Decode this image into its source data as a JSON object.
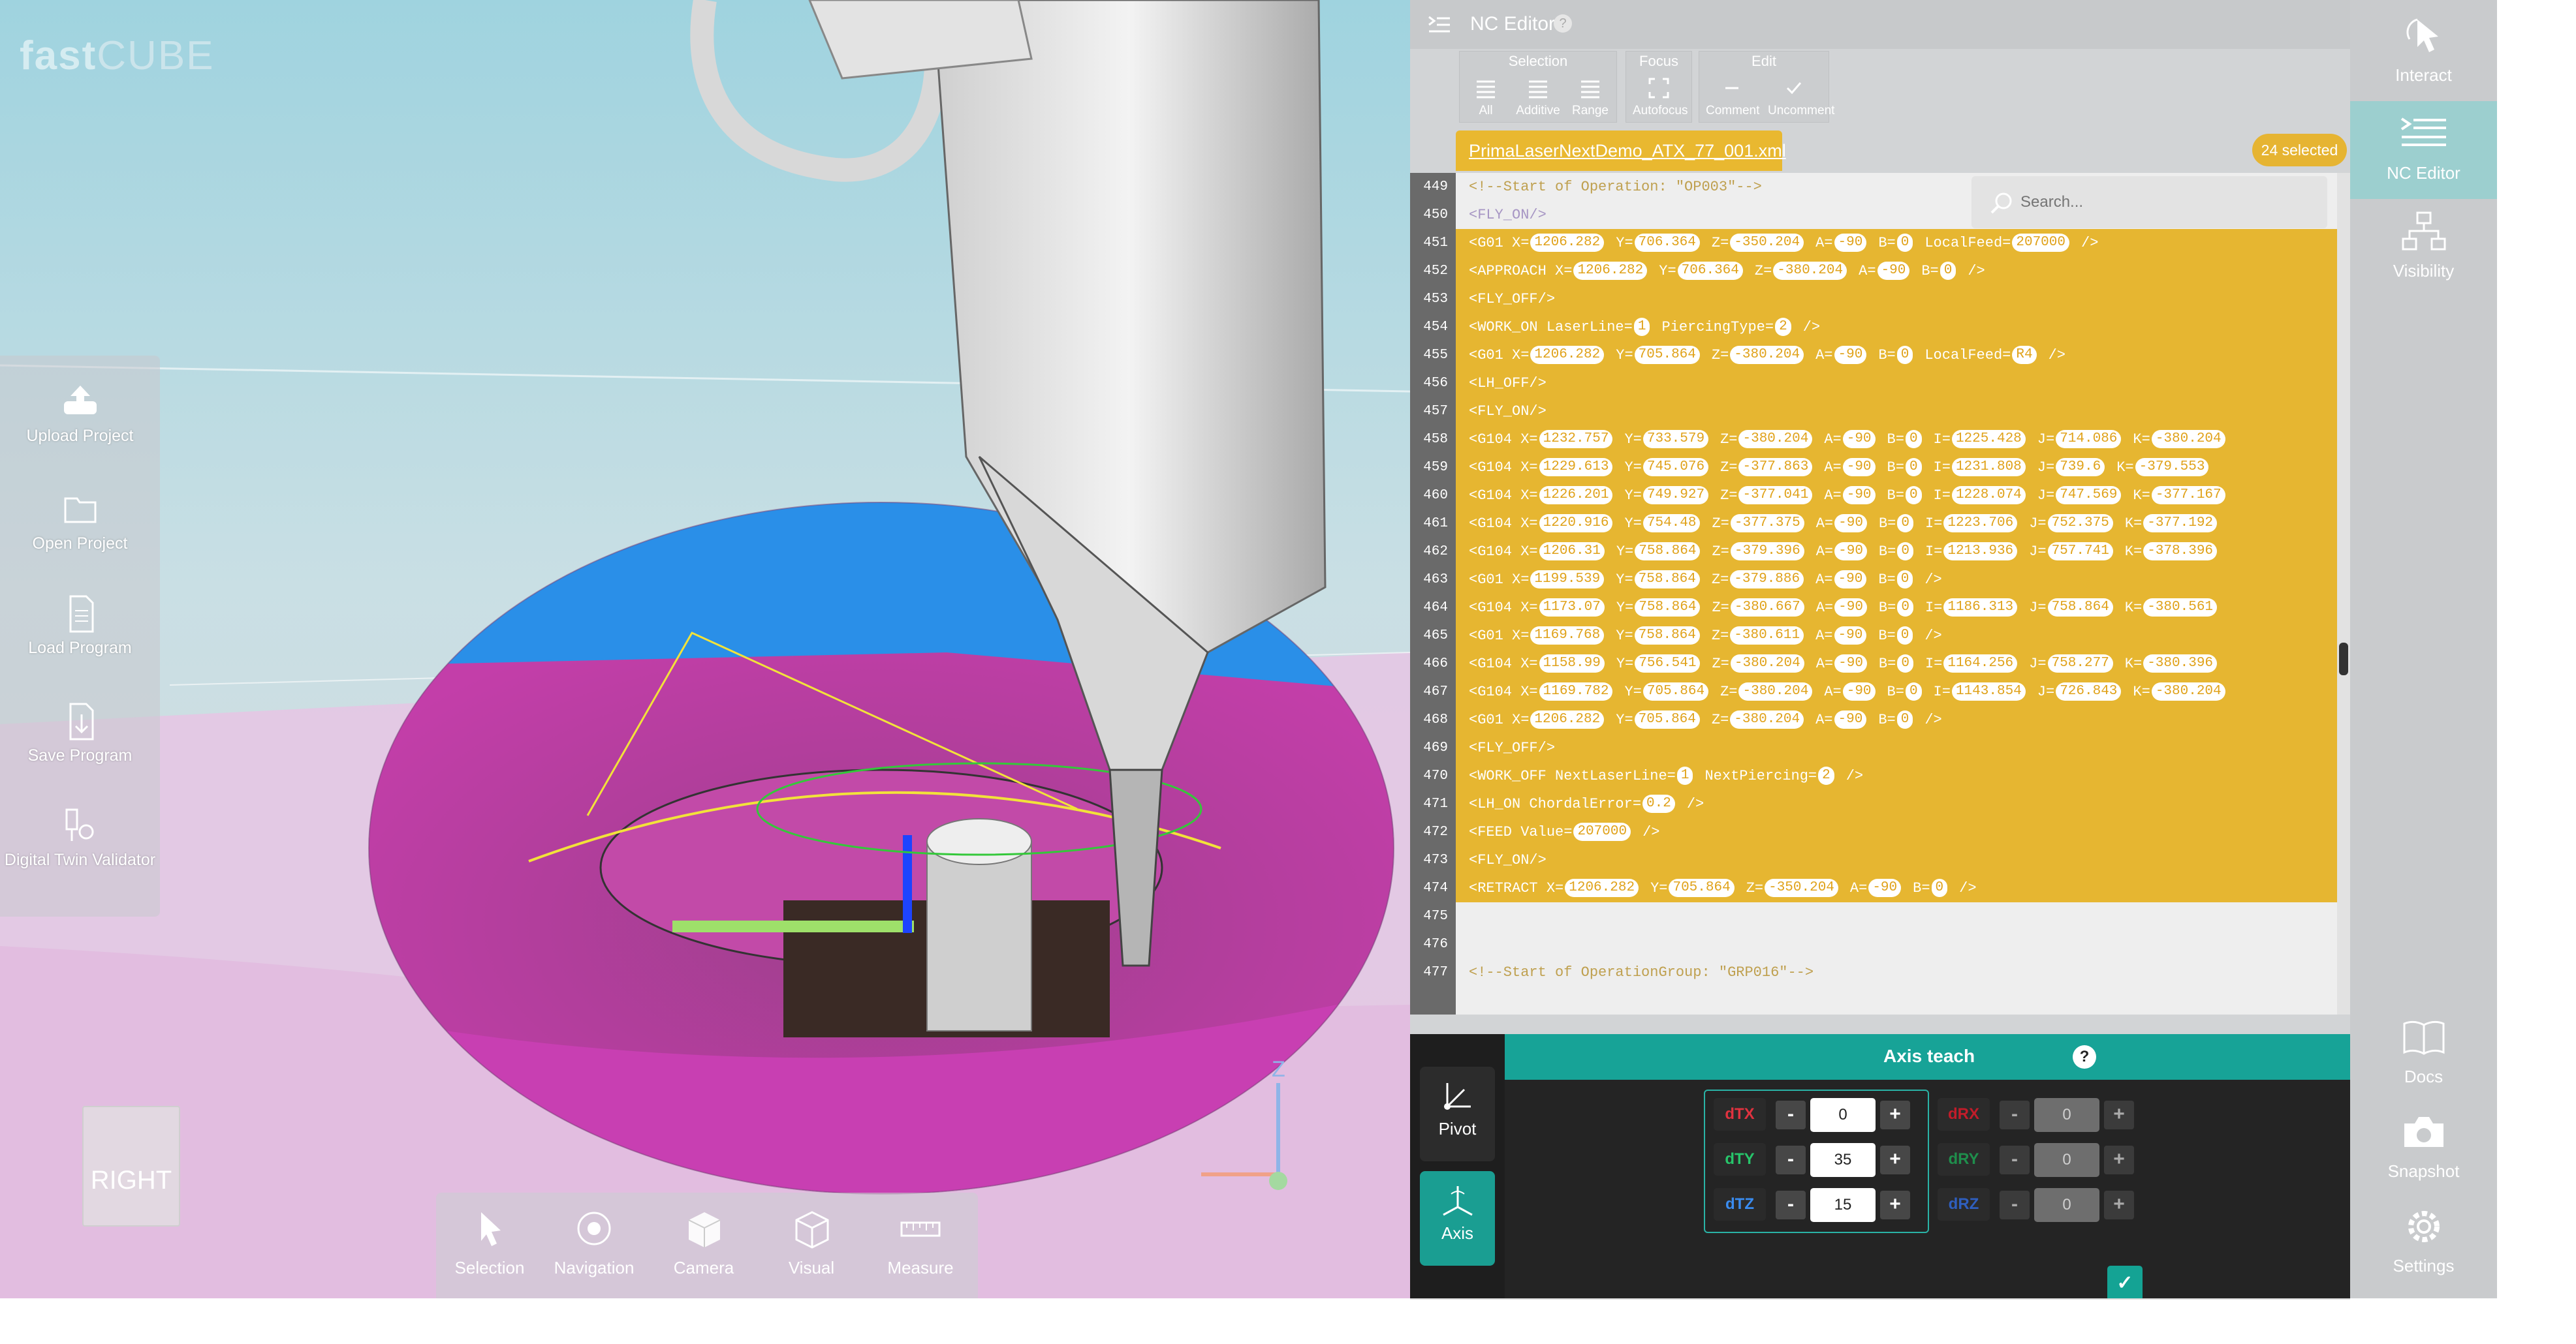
{
  "logo": {
    "fast": "fast",
    "cube": "CUBE"
  },
  "left_tools": [
    {
      "label": "Upload Project",
      "icon": "upload-project-icon"
    },
    {
      "label": "Open Project",
      "icon": "folder-icon"
    },
    {
      "label": "Load Program",
      "icon": "document-icon"
    },
    {
      "label": "Save Program",
      "icon": "save-program-icon"
    },
    {
      "label": "Digital Twin Validator",
      "icon": "digital-twin-icon"
    }
  ],
  "view_cube": {
    "face": "RIGHT"
  },
  "bottom_tools": [
    {
      "label": "Selection",
      "icon": "cursor-icon"
    },
    {
      "label": "Navigation",
      "icon": "navigation-icon"
    },
    {
      "label": "Camera",
      "icon": "camera-cube-icon"
    },
    {
      "label": "Visual",
      "icon": "visual-cube-icon"
    },
    {
      "label": "Measure",
      "icon": "ruler-icon"
    }
  ],
  "axis_gizmo": {
    "z_label": "Z"
  },
  "nc_editor": {
    "title": "NC Editor",
    "help": "?",
    "ribbon": {
      "selection": {
        "title": "Selection",
        "buttons": [
          "All",
          "Additive",
          "Range"
        ]
      },
      "focus": {
        "title": "Focus",
        "buttons": [
          "Autofocus"
        ]
      },
      "edit": {
        "title": "Edit",
        "buttons": [
          "Comment",
          "Uncomment"
        ]
      }
    },
    "file_tab": "PrimaLaserNextDemo_ATX_77_001.xml",
    "selected_badge": "24 selected",
    "search_placeholder": "Search...",
    "lines": [
      {
        "n": "449",
        "style": "cmt",
        "parts": [
          {
            "t": "<!--Start of Operation: \"OP003\"-->"
          }
        ]
      },
      {
        "n": "450",
        "style": "dim",
        "parts": [
          {
            "t": "<FLY_ON/>"
          }
        ]
      },
      {
        "n": "451",
        "style": "hl",
        "parts": [
          {
            "t": "<G01 X="
          },
          {
            "v": "1206.282"
          },
          {
            "t": "Y="
          },
          {
            "v": "706.364"
          },
          {
            "t": "Z="
          },
          {
            "v": "-350.204"
          },
          {
            "t": "A="
          },
          {
            "v": "-90"
          },
          {
            "t": "B="
          },
          {
            "v": "0"
          },
          {
            "t": "LocalFeed="
          },
          {
            "v": "207000"
          },
          {
            "t": "/>"
          }
        ]
      },
      {
        "n": "452",
        "style": "hl",
        "parts": [
          {
            "t": "<APPROACH X="
          },
          {
            "v": "1206.282"
          },
          {
            "t": "Y="
          },
          {
            "v": "706.364"
          },
          {
            "t": "Z="
          },
          {
            "v": "-380.204"
          },
          {
            "t": "A="
          },
          {
            "v": "-90"
          },
          {
            "t": "B="
          },
          {
            "v": "0"
          },
          {
            "t": "/>"
          }
        ]
      },
      {
        "n": "453",
        "style": "hl",
        "parts": [
          {
            "t": "<FLY_OFF/>"
          }
        ]
      },
      {
        "n": "454",
        "style": "hl",
        "parts": [
          {
            "t": "<WORK_ON  LaserLine="
          },
          {
            "v": "1"
          },
          {
            "t": "PiercingType="
          },
          {
            "v": "2"
          },
          {
            "t": "/>"
          }
        ]
      },
      {
        "n": "455",
        "style": "hl",
        "parts": [
          {
            "t": "<G01 X="
          },
          {
            "v": "1206.282"
          },
          {
            "t": "Y="
          },
          {
            "v": "705.864"
          },
          {
            "t": "Z="
          },
          {
            "v": "-380.204"
          },
          {
            "t": "A="
          },
          {
            "v": "-90"
          },
          {
            "t": "B="
          },
          {
            "v": "0"
          },
          {
            "t": "LocalFeed="
          },
          {
            "v": "R4"
          },
          {
            "t": "/>"
          }
        ]
      },
      {
        "n": "456",
        "style": "hl",
        "parts": [
          {
            "t": "<LH_OFF/>"
          }
        ]
      },
      {
        "n": "457",
        "style": "hl",
        "parts": [
          {
            "t": "<FLY_ON/>"
          }
        ]
      },
      {
        "n": "458",
        "style": "hl",
        "parts": [
          {
            "t": "<G104 X="
          },
          {
            "v": "1232.757"
          },
          {
            "t": "Y="
          },
          {
            "v": "733.579"
          },
          {
            "t": "Z="
          },
          {
            "v": "-380.204"
          },
          {
            "t": "A="
          },
          {
            "v": "-90"
          },
          {
            "t": "B="
          },
          {
            "v": "0"
          },
          {
            "t": "I="
          },
          {
            "v": "1225.428"
          },
          {
            "t": "J="
          },
          {
            "v": "714.086"
          },
          {
            "t": "K="
          },
          {
            "v": "-380.204"
          }
        ]
      },
      {
        "n": "459",
        "style": "hl",
        "parts": [
          {
            "t": "<G104 X="
          },
          {
            "v": "1229.613"
          },
          {
            "t": "Y="
          },
          {
            "v": "745.076"
          },
          {
            "t": "Z="
          },
          {
            "v": "-377.863"
          },
          {
            "t": "A="
          },
          {
            "v": "-90"
          },
          {
            "t": "B="
          },
          {
            "v": "0"
          },
          {
            "t": "I="
          },
          {
            "v": "1231.808"
          },
          {
            "t": "J="
          },
          {
            "v": "739.6"
          },
          {
            "t": "K="
          },
          {
            "v": "-379.553"
          }
        ]
      },
      {
        "n": "460",
        "style": "hl",
        "parts": [
          {
            "t": "<G104 X="
          },
          {
            "v": "1226.201"
          },
          {
            "t": "Y="
          },
          {
            "v": "749.927"
          },
          {
            "t": "Z="
          },
          {
            "v": "-377.041"
          },
          {
            "t": "A="
          },
          {
            "v": "-90"
          },
          {
            "t": "B="
          },
          {
            "v": "0"
          },
          {
            "t": "I="
          },
          {
            "v": "1228.074"
          },
          {
            "t": "J="
          },
          {
            "v": "747.569"
          },
          {
            "t": "K="
          },
          {
            "v": "-377.167"
          }
        ]
      },
      {
        "n": "461",
        "style": "hl",
        "parts": [
          {
            "t": "<G104 X="
          },
          {
            "v": "1220.916"
          },
          {
            "t": "Y="
          },
          {
            "v": "754.48"
          },
          {
            "t": "Z="
          },
          {
            "v": "-377.375"
          },
          {
            "t": "A="
          },
          {
            "v": "-90"
          },
          {
            "t": "B="
          },
          {
            "v": "0"
          },
          {
            "t": "I="
          },
          {
            "v": "1223.706"
          },
          {
            "t": "J="
          },
          {
            "v": "752.375"
          },
          {
            "t": "K="
          },
          {
            "v": "-377.192"
          }
        ]
      },
      {
        "n": "462",
        "style": "hl",
        "parts": [
          {
            "t": "<G104 X="
          },
          {
            "v": "1206.31"
          },
          {
            "t": "Y="
          },
          {
            "v": "758.864"
          },
          {
            "t": "Z="
          },
          {
            "v": "-379.396"
          },
          {
            "t": "A="
          },
          {
            "v": "-90"
          },
          {
            "t": "B="
          },
          {
            "v": "0"
          },
          {
            "t": "I="
          },
          {
            "v": "1213.936"
          },
          {
            "t": "J="
          },
          {
            "v": "757.741"
          },
          {
            "t": "K="
          },
          {
            "v": "-378.396"
          }
        ]
      },
      {
        "n": "463",
        "style": "hl",
        "parts": [
          {
            "t": "<G01 X="
          },
          {
            "v": "1199.539"
          },
          {
            "t": "Y="
          },
          {
            "v": "758.864"
          },
          {
            "t": "Z="
          },
          {
            "v": "-379.886"
          },
          {
            "t": "A="
          },
          {
            "v": "-90"
          },
          {
            "t": "B="
          },
          {
            "v": "0"
          },
          {
            "t": "/>"
          }
        ]
      },
      {
        "n": "464",
        "style": "hl",
        "parts": [
          {
            "t": "<G104 X="
          },
          {
            "v": "1173.07"
          },
          {
            "t": "Y="
          },
          {
            "v": "758.864"
          },
          {
            "t": "Z="
          },
          {
            "v": "-380.667"
          },
          {
            "t": "A="
          },
          {
            "v": "-90"
          },
          {
            "t": "B="
          },
          {
            "v": "0"
          },
          {
            "t": "I="
          },
          {
            "v": "1186.313"
          },
          {
            "t": "J="
          },
          {
            "v": "758.864"
          },
          {
            "t": "K="
          },
          {
            "v": "-380.561"
          }
        ]
      },
      {
        "n": "465",
        "style": "hl",
        "parts": [
          {
            "t": "<G01 X="
          },
          {
            "v": "1169.768"
          },
          {
            "t": "Y="
          },
          {
            "v": "758.864"
          },
          {
            "t": "Z="
          },
          {
            "v": "-380.611"
          },
          {
            "t": "A="
          },
          {
            "v": "-90"
          },
          {
            "t": "B="
          },
          {
            "v": "0"
          },
          {
            "t": "/>"
          }
        ]
      },
      {
        "n": "466",
        "style": "hl",
        "parts": [
          {
            "t": "<G104 X="
          },
          {
            "v": "1158.99"
          },
          {
            "t": "Y="
          },
          {
            "v": "756.541"
          },
          {
            "t": "Z="
          },
          {
            "v": "-380.204"
          },
          {
            "t": "A="
          },
          {
            "v": "-90"
          },
          {
            "t": "B="
          },
          {
            "v": "0"
          },
          {
            "t": "I="
          },
          {
            "v": "1164.256"
          },
          {
            "t": "J="
          },
          {
            "v": "758.277"
          },
          {
            "t": "K="
          },
          {
            "v": "-380.396"
          }
        ]
      },
      {
        "n": "467",
        "style": "hl",
        "parts": [
          {
            "t": "<G104 X="
          },
          {
            "v": "1169.782"
          },
          {
            "t": "Y="
          },
          {
            "v": "705.864"
          },
          {
            "t": "Z="
          },
          {
            "v": "-380.204"
          },
          {
            "t": "A="
          },
          {
            "v": "-90"
          },
          {
            "t": "B="
          },
          {
            "v": "0"
          },
          {
            "t": "I="
          },
          {
            "v": "1143.854"
          },
          {
            "t": "J="
          },
          {
            "v": "726.843"
          },
          {
            "t": "K="
          },
          {
            "v": "-380.204"
          }
        ]
      },
      {
        "n": "468",
        "style": "hl",
        "parts": [
          {
            "t": "<G01 X="
          },
          {
            "v": "1206.282"
          },
          {
            "t": "Y="
          },
          {
            "v": "705.864"
          },
          {
            "t": "Z="
          },
          {
            "v": "-380.204"
          },
          {
            "t": "A="
          },
          {
            "v": "-90"
          },
          {
            "t": "B="
          },
          {
            "v": "0"
          },
          {
            "t": "/>"
          }
        ]
      },
      {
        "n": "469",
        "style": "hl",
        "parts": [
          {
            "t": "<FLY_OFF/>"
          }
        ]
      },
      {
        "n": "470",
        "style": "hl",
        "parts": [
          {
            "t": "<WORK_OFF NextLaserLine="
          },
          {
            "v": "1"
          },
          {
            "t": "NextPiercing="
          },
          {
            "v": "2"
          },
          {
            "t": "/>"
          }
        ]
      },
      {
        "n": "471",
        "style": "hl",
        "parts": [
          {
            "t": "<LH_ON ChordalError="
          },
          {
            "v": "0.2"
          },
          {
            "t": "/>"
          }
        ]
      },
      {
        "n": "472",
        "style": "hl",
        "parts": [
          {
            "t": "<FEED Value="
          },
          {
            "v": "207000"
          },
          {
            "t": "/>"
          }
        ]
      },
      {
        "n": "473",
        "style": "hl",
        "parts": [
          {
            "t": "<FLY_ON/>"
          }
        ]
      },
      {
        "n": "474",
        "style": "hl",
        "parts": [
          {
            "t": "<RETRACT X="
          },
          {
            "v": "1206.282"
          },
          {
            "t": "Y="
          },
          {
            "v": "705.864"
          },
          {
            "t": "Z="
          },
          {
            "v": "-350.204"
          },
          {
            "t": "A="
          },
          {
            "v": "-90"
          },
          {
            "t": "B="
          },
          {
            "v": "0"
          },
          {
            "t": "/>"
          }
        ]
      },
      {
        "n": "475",
        "style": "plain",
        "parts": [
          {
            "t": ""
          }
        ]
      },
      {
        "n": "476",
        "style": "plain",
        "parts": [
          {
            "t": ""
          }
        ]
      },
      {
        "n": "477",
        "style": "cmt",
        "parts": [
          {
            "t": "<!--Start of OperationGroup: \"GRP016\"-->"
          }
        ]
      }
    ]
  },
  "axis_teach": {
    "title": "Axis teach",
    "help": "?",
    "side": [
      {
        "label": "Pivot"
      },
      {
        "label": "Axis"
      }
    ],
    "translations": [
      {
        "label": "dTX",
        "value": "0",
        "color": "#e0323f"
      },
      {
        "label": "dTY",
        "value": "35",
        "color": "#27c46a"
      },
      {
        "label": "dTZ",
        "value": "15",
        "color": "#3a8cf0"
      }
    ],
    "rotations": [
      {
        "label": "dRX",
        "value": "0",
        "color": "#c21c2a"
      },
      {
        "label": "dRY",
        "value": "0",
        "color": "#1f8e4c"
      },
      {
        "label": "dRZ",
        "value": "0",
        "color": "#2f5fbf"
      }
    ],
    "minus": "-",
    "plus": "+",
    "apply": "✓"
  },
  "right_rail": [
    {
      "label": "Interact",
      "icon": "interact-cursor-icon"
    },
    {
      "label": "NC Editor",
      "icon": "nc-editor-icon",
      "active": true
    },
    {
      "label": "Visibility",
      "icon": "hierarchy-icon"
    },
    {
      "label": "Docs",
      "icon": "book-icon"
    },
    {
      "label": "Snapshot",
      "icon": "camera-icon"
    },
    {
      "label": "Settings",
      "icon": "gear-icon"
    }
  ]
}
